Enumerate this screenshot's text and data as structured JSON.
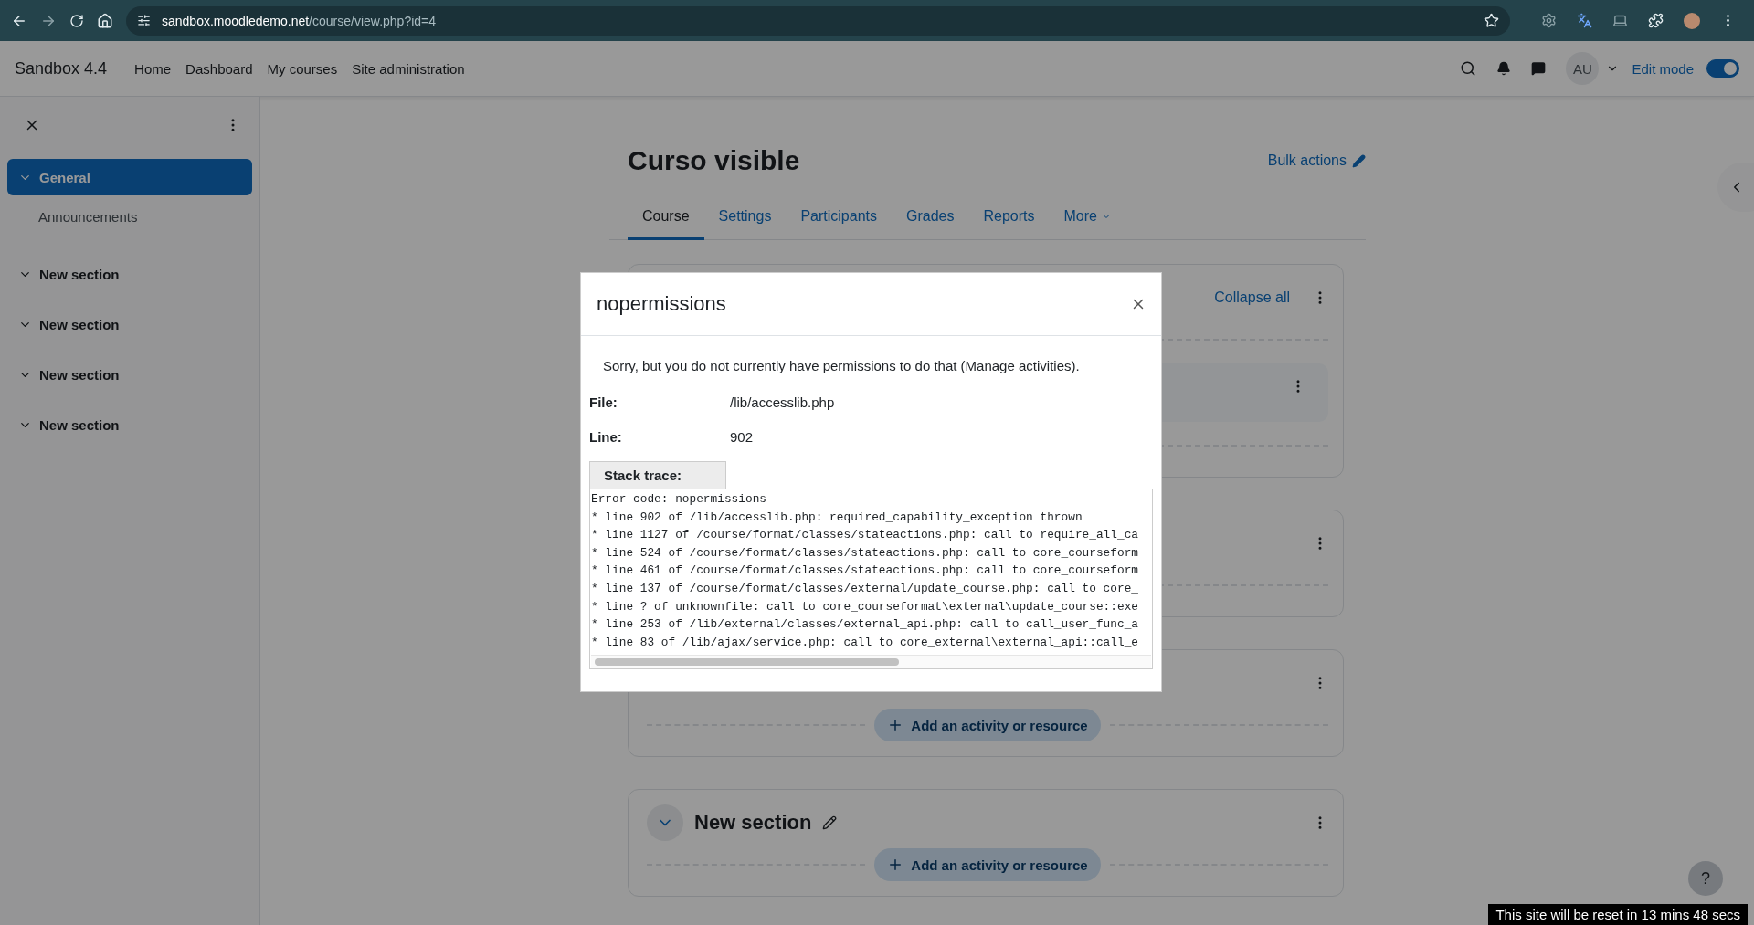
{
  "browser": {
    "url_host": "sandbox.moodledemo.net",
    "url_path": "/course/view.php?id=4"
  },
  "navbar": {
    "brand": "Sandbox 4.4",
    "links": [
      "Home",
      "Dashboard",
      "My courses",
      "Site administration"
    ],
    "user_initials": "AU",
    "edit_mode": {
      "label": "Edit mode",
      "on": true
    }
  },
  "sidebar": {
    "items": [
      {
        "label": "General",
        "selected": true,
        "expanded": true,
        "children": [
          {
            "label": "Announcements"
          }
        ]
      },
      {
        "label": "New section",
        "selected": false,
        "expanded": true
      },
      {
        "label": "New section",
        "selected": false,
        "expanded": true
      },
      {
        "label": "New section",
        "selected": false,
        "expanded": true
      },
      {
        "label": "New section",
        "selected": false,
        "expanded": true
      }
    ]
  },
  "course": {
    "title": "Curso visible",
    "bulk_actions": "Bulk actions",
    "tabs": [
      {
        "label": "Course",
        "selected": true,
        "kind": "link"
      },
      {
        "label": "Settings",
        "selected": false,
        "kind": "link"
      },
      {
        "label": "Participants",
        "selected": false,
        "kind": "link"
      },
      {
        "label": "Grades",
        "selected": false,
        "kind": "link"
      },
      {
        "label": "Reports",
        "selected": false,
        "kind": "link"
      },
      {
        "label": "More",
        "selected": false,
        "kind": "menu"
      }
    ],
    "sections": [
      {
        "kind": "general",
        "collapse_all": "Collapse all"
      },
      {
        "kind": "section"
      },
      {
        "kind": "section",
        "add_button": "Add an activity or resource"
      },
      {
        "kind": "section",
        "title": "New section",
        "add_button": "Add an activity or resource"
      }
    ]
  },
  "help_button": "?",
  "reset_notice": "This site will be reset in 13 mins 48 secs",
  "dialog": {
    "title": "nopermissions",
    "message": "Sorry, but you do not currently have permissions to do that (Manage activities).",
    "fields": [
      {
        "label": "File:",
        "value": "/lib/accesslib.php"
      },
      {
        "label": "Line:",
        "value": "902"
      }
    ],
    "stack_trace_label": "Stack trace:",
    "trace_lines": [
      "Error code: nopermissions",
      "* line 902 of /lib/accesslib.php: required_capability_exception thrown",
      "* line 1127 of /course/format/classes/stateactions.php: call to require_all_ca",
      "* line 524 of /course/format/classes/stateactions.php: call to core_courseform",
      "* line 461 of /course/format/classes/stateactions.php: call to core_courseform",
      "* line 137 of /course/format/classes/external/update_course.php: call to core_",
      "* line ? of unknownfile: call to core_courseformat\\external\\update_course::exe",
      "* line 253 of /lib/external/classes/external_api.php: call to call_user_func_a",
      "* line 83 of /lib/ajax/service.php: call to core_external\\external_api::call_e"
    ]
  }
}
